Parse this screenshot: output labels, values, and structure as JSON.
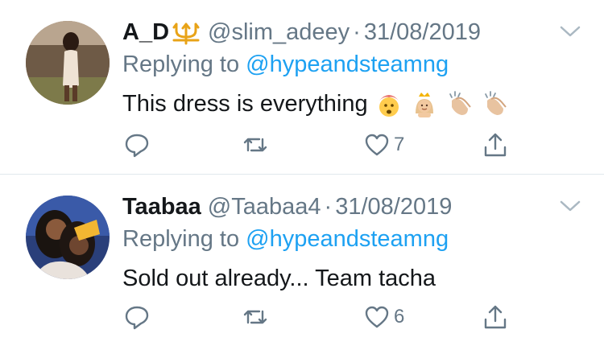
{
  "tweets": [
    {
      "display_name": "A_D",
      "badge_icon": "trident-icon",
      "handle": "@slim_adeey",
      "separator": "·",
      "date": "31/08/2019",
      "replying_prefix": "Replying to",
      "replying_to": "@hypeandsteamng",
      "text": "This dress is everything",
      "emojis": [
        "exploding-head-emoji",
        "princess-emoji",
        "clapping-hands-emoji",
        "clapping-hands-emoji"
      ],
      "reply_count": "",
      "retweet_count": "",
      "like_count": "7"
    },
    {
      "display_name": "Taabaa",
      "handle": "@Taabaa4",
      "separator": "·",
      "date": "31/08/2019",
      "replying_prefix": "Replying to",
      "replying_to": "@hypeandsteamng",
      "text": "Sold out already... Team tacha",
      "emojis": [],
      "reply_count": "",
      "retweet_count": "",
      "like_count": "6"
    }
  ],
  "icons": [
    "reply-icon",
    "retweet-icon",
    "like-icon",
    "share-icon",
    "chevron-down-icon"
  ],
  "colors": {
    "text": "#14171a",
    "secondary": "#657786",
    "mention": "#1da1f2",
    "divider": "#e1e8ed"
  }
}
